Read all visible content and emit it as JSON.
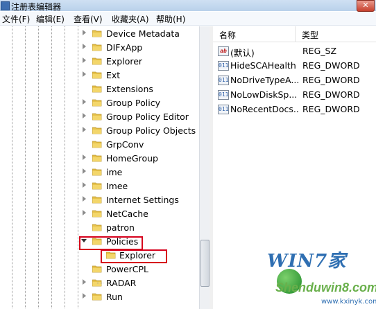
{
  "window": {
    "title": "注册表编辑器",
    "close_glyph": "✕"
  },
  "menu": [
    "文件(F)",
    "编辑(E)",
    "查看(V)",
    "收藏夹(A)",
    "帮助(H)"
  ],
  "tree": {
    "items": [
      {
        "label": "Device Metadata",
        "expander": "collapsed"
      },
      {
        "label": "DIFxApp",
        "expander": "collapsed"
      },
      {
        "label": "Explorer",
        "expander": "collapsed"
      },
      {
        "label": "Ext",
        "expander": "collapsed"
      },
      {
        "label": "Extensions",
        "expander": "none"
      },
      {
        "label": "Group Policy",
        "expander": "collapsed"
      },
      {
        "label": "Group Policy Editor",
        "expander": "collapsed"
      },
      {
        "label": "Group Policy Objects",
        "expander": "collapsed"
      },
      {
        "label": "GrpConv",
        "expander": "none"
      },
      {
        "label": "HomeGroup",
        "expander": "collapsed"
      },
      {
        "label": "ime",
        "expander": "collapsed"
      },
      {
        "label": "Imee",
        "expander": "collapsed"
      },
      {
        "label": "Internet Settings",
        "expander": "collapsed"
      },
      {
        "label": "NetCache",
        "expander": "collapsed"
      },
      {
        "label": "patron",
        "expander": "none"
      },
      {
        "label": "Policies",
        "expander": "expanded"
      },
      {
        "label": "Explorer",
        "expander": "none",
        "child": true,
        "selected": true
      },
      {
        "label": "PowerCPL",
        "expander": "none"
      },
      {
        "label": "RADAR",
        "expander": "collapsed"
      },
      {
        "label": "Run",
        "expander": "collapsed"
      }
    ]
  },
  "list": {
    "headers": {
      "name": "名称",
      "type": "类型"
    },
    "rows": [
      {
        "icon": "string-value-icon",
        "icon_text": "ab",
        "name": "(默认)",
        "type": "REG_SZ"
      },
      {
        "icon": "dword-value-icon",
        "icon_text": "011",
        "name": "HideSCAHealth",
        "type": "REG_DWORD"
      },
      {
        "icon": "dword-value-icon",
        "icon_text": "011",
        "name": "NoDriveTypeA...",
        "type": "REG_DWORD"
      },
      {
        "icon": "dword-value-icon",
        "icon_text": "011",
        "name": "NoLowDiskSp...",
        "type": "REG_DWORD"
      },
      {
        "icon": "dword-value-icon",
        "icon_text": "011",
        "name": "NoRecentDocs...",
        "type": "REG_DWORD"
      }
    ]
  },
  "watermark": {
    "brand": "WIN7家",
    "site": "Shenduwin8.com",
    "url": "www.kxinyk.com"
  },
  "colors": {
    "highlight": "#d6001c",
    "folder": "#e7c24a",
    "title_bar": "#cfe0f3"
  }
}
